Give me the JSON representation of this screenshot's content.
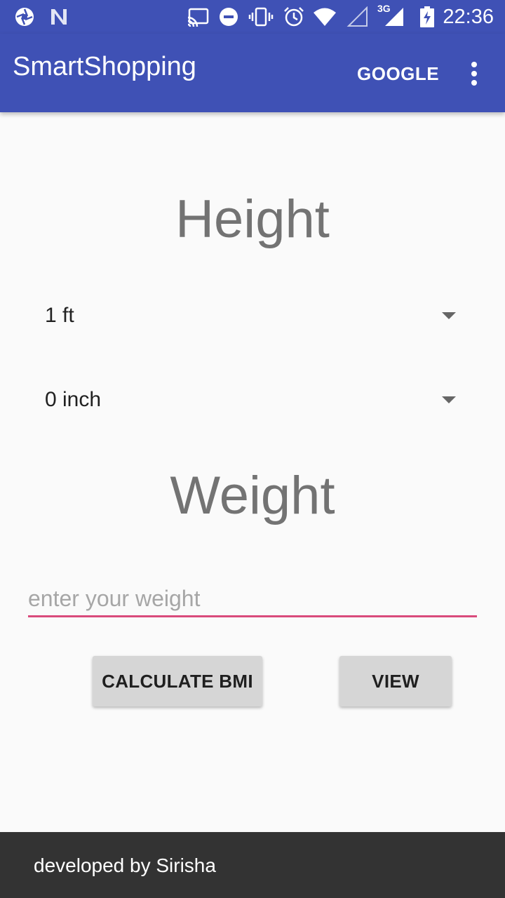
{
  "status_bar": {
    "time": "22:36",
    "network_type": "3G",
    "icons": [
      "aperture-icon",
      "n-notification-icon",
      "cast-icon",
      "do-not-disturb-icon",
      "vibrate-icon",
      "alarm-icon",
      "wifi-icon",
      "signal-empty-icon",
      "signal-3g-icon",
      "battery-charging-icon"
    ]
  },
  "app_bar": {
    "title": "SmartShopping",
    "action_label": "GOOGLE",
    "overflow_icon": "more-vert-icon"
  },
  "height_section": {
    "title": "Height",
    "feet_value": "1 ft",
    "inch_value": "0 inch"
  },
  "weight_section": {
    "title": "Weight",
    "input_value": "",
    "input_placeholder": "enter your weight"
  },
  "buttons": {
    "calculate_label": "CALCULATE BMI",
    "view_label": "VIEW"
  },
  "footer": {
    "text": "developed by Sirisha"
  },
  "colors": {
    "primary": "#3f51b5",
    "accent": "#d94b7c",
    "footer_bg": "#333333",
    "button_bg": "#d6d6d6"
  }
}
